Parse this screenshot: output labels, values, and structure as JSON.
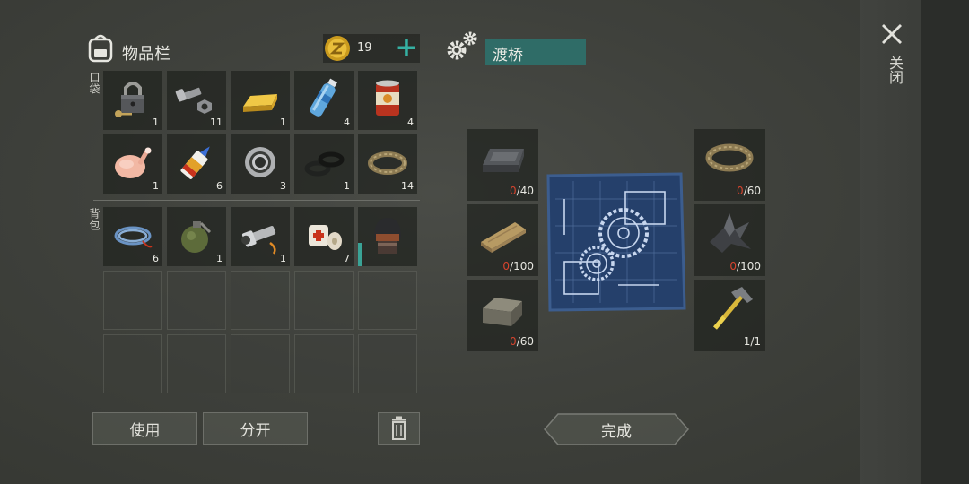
{
  "inventory": {
    "title": "物品栏",
    "coins": "19",
    "add_symbol": "+",
    "pocket_label": "口袋",
    "backpack_label": "背包",
    "pocket_items": [
      {
        "icon": "padlock-icon",
        "qty": "1"
      },
      {
        "icon": "bolt-nut-icon",
        "qty": "11"
      },
      {
        "icon": "gold-bar-icon",
        "qty": "1"
      },
      {
        "icon": "water-bottle-icon",
        "qty": "4"
      },
      {
        "icon": "canned-food-icon",
        "qty": "4"
      },
      {
        "icon": "raw-chicken-icon",
        "qty": "1"
      },
      {
        "icon": "glue-tube-icon",
        "qty": "6"
      },
      {
        "icon": "bearing-icon",
        "qty": "3"
      },
      {
        "icon": "rubber-rings-icon",
        "qty": "1"
      },
      {
        "icon": "rope-icon",
        "qty": "14"
      }
    ],
    "backpack_items": [
      {
        "icon": "wire-coil-icon",
        "qty": "6"
      },
      {
        "icon": "grenade-icon",
        "qty": "1"
      },
      {
        "icon": "flashlight-icon",
        "qty": "1"
      },
      {
        "icon": "bandage-icon",
        "qty": "7"
      },
      {
        "icon": "helmet-icon",
        "qty": "",
        "durability": 0.4
      }
    ],
    "empty_slot_count": 10,
    "use_button": "使用",
    "split_button": "分开",
    "delete_icon": "trash-icon"
  },
  "crafting": {
    "title": "渡桥",
    "left_requirements": [
      {
        "icon": "iron-ingot-icon",
        "have": "0",
        "need": "/40"
      },
      {
        "icon": "wood-plank-icon",
        "have": "0",
        "need": "/100"
      },
      {
        "icon": "stone-block-icon",
        "have": "0",
        "need": "/60"
      }
    ],
    "right_requirements": [
      {
        "icon": "rope-icon",
        "have": "0",
        "need": "/60"
      },
      {
        "icon": "scrap-metal-icon",
        "have": "0",
        "need": "/100"
      },
      {
        "icon": "hammer-icon",
        "have": "",
        "need": "1/1"
      }
    ],
    "blueprint_icon": "blueprint-icon",
    "done_button": "完成"
  },
  "window": {
    "close_symbol": "✕",
    "close_label": "关闭"
  },
  "colors": {
    "accent_teal": "#35b0a2",
    "title_bg": "#2f6c67",
    "missing_red": "#d8442e"
  }
}
